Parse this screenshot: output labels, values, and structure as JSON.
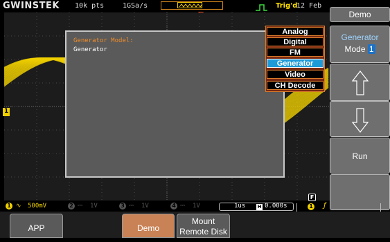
{
  "status_bar": {
    "brand": "GWINSTEK",
    "record_length": "10k pts",
    "sample_rate": "1GSa/s",
    "trigger_status": "Trig'd",
    "date": "12 Feb"
  },
  "message_window": {
    "title": "Generator Model:",
    "body": "Generator"
  },
  "popup_list": {
    "items": [
      "Analog",
      "Digital",
      "FM",
      "Generator",
      "Video",
      "CH Decode"
    ],
    "selected": "Generator"
  },
  "side_menu": {
    "title": "Demo",
    "mode_button": {
      "line1": "Generator",
      "line2": "Mode",
      "value": "1"
    },
    "up_icon": "up-arrow-icon",
    "down_icon": "down-arrow-icon",
    "run_label": "Run"
  },
  "channel_bar": {
    "ch1": {
      "number": "1",
      "scale": "500mV",
      "coupling_icon": "ac-coupling-icon"
    },
    "ch2": {
      "number": "2",
      "scale": "1V"
    },
    "ch3": {
      "number": "3",
      "scale": "1V"
    },
    "ch4": {
      "number": "4",
      "scale": "1V"
    },
    "timebase": "1us",
    "horizontal_position": "0.000s",
    "trigger_source": "1",
    "fine_marker": "F",
    "ground_marker": "1"
  },
  "bottom_menu": {
    "app": "APP",
    "demo": "Demo",
    "mount_line1": "Mount",
    "mount_line2": "Remote Disk"
  },
  "colors": {
    "ch1": "#f0d000",
    "accent_orange": "#d87a2a",
    "selected_blue": "#1d9ad8",
    "trigger_yellow": "#ffe000"
  }
}
